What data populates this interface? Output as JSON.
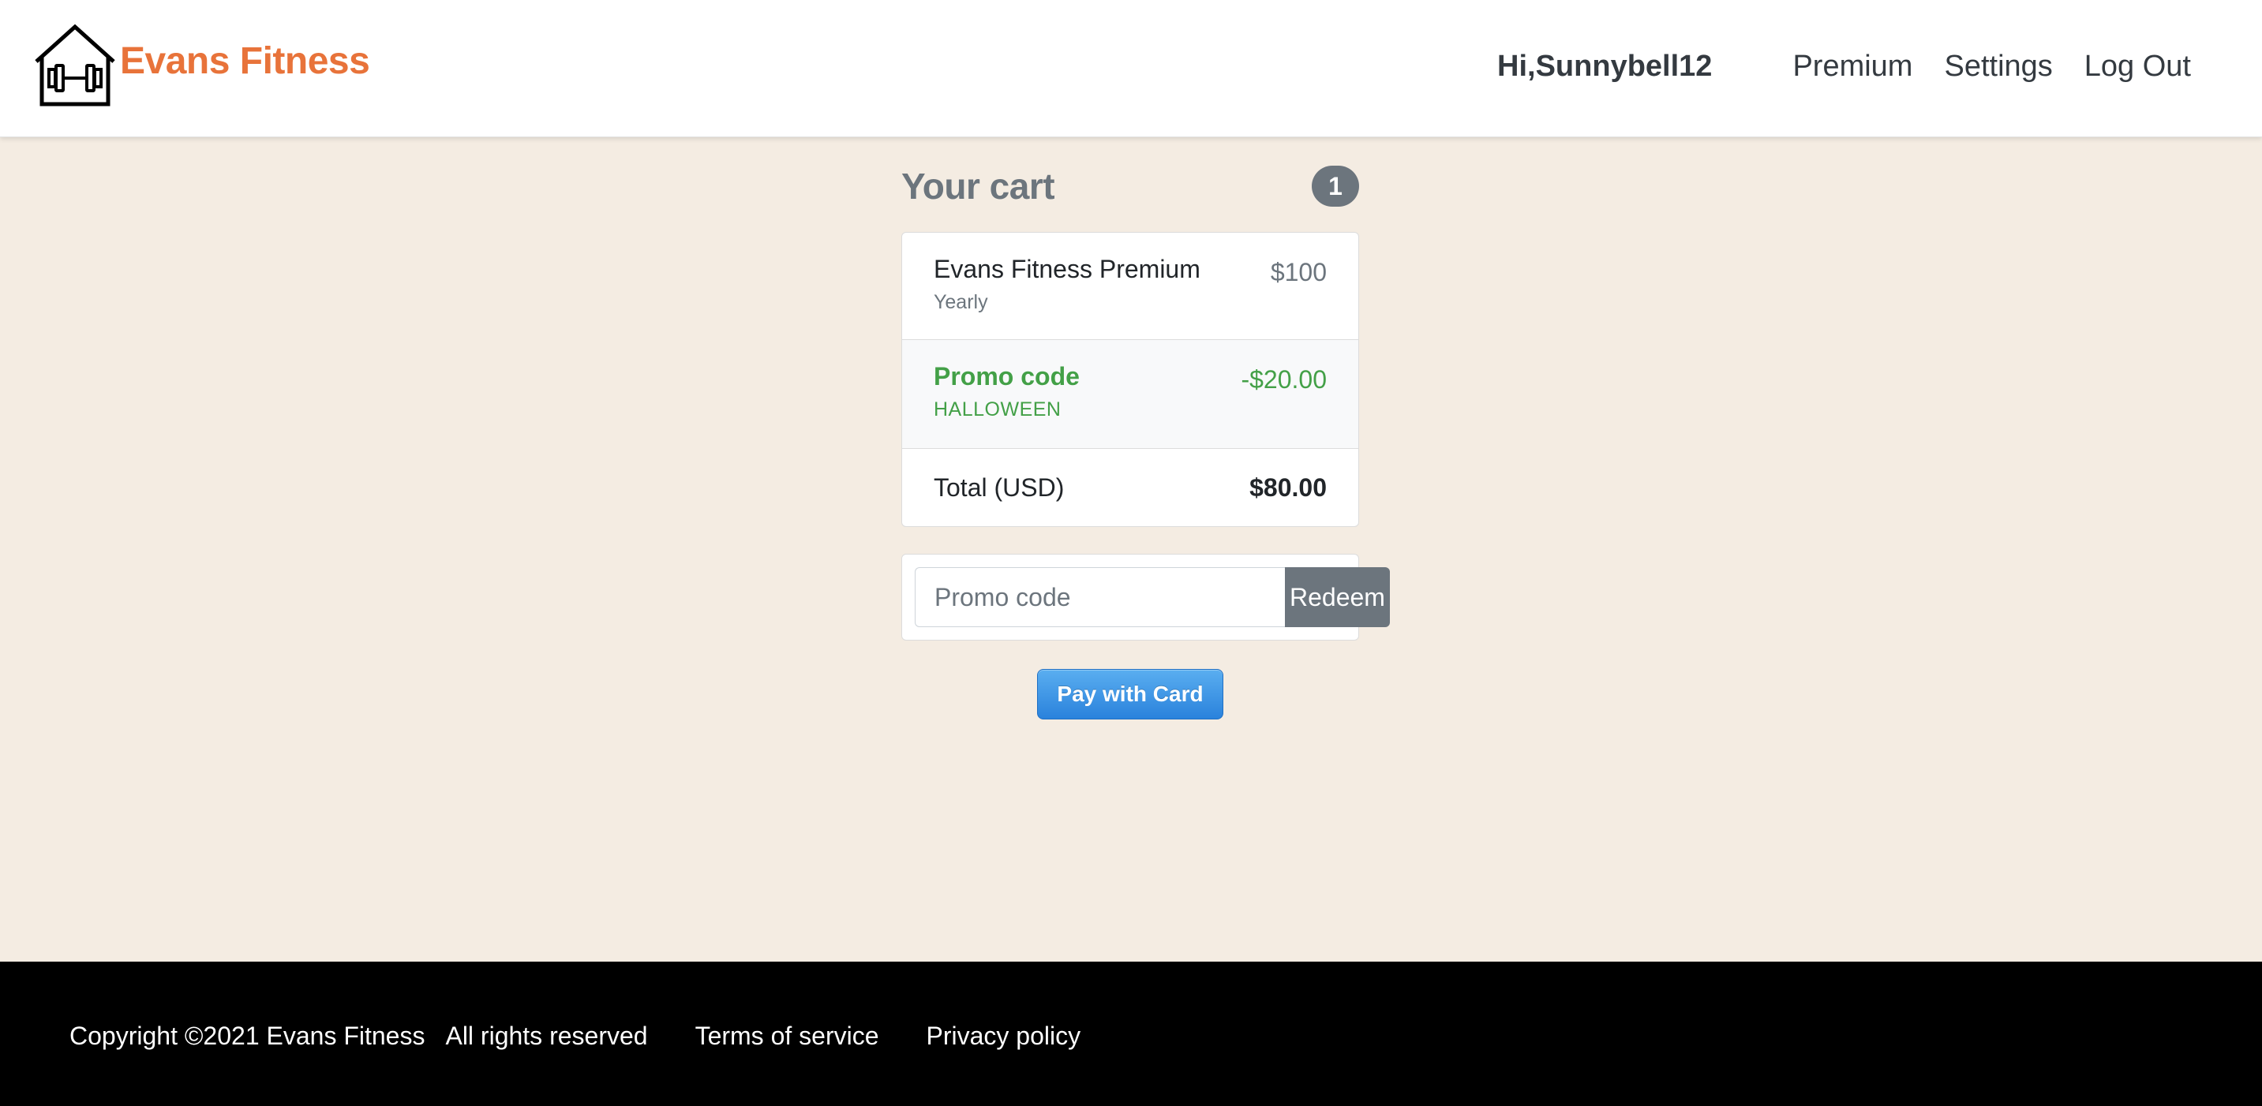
{
  "brand": {
    "name": "Evans Fitness",
    "color": "#e8733a"
  },
  "nav": {
    "greeting": "Hi,Sunnybell12",
    "links": [
      "Premium",
      "Settings",
      "Log Out"
    ]
  },
  "cart": {
    "title": "Your cart",
    "count": "1",
    "item": {
      "name": "Evans Fitness Premium",
      "period": "Yearly",
      "price": "$100"
    },
    "promo": {
      "label": "Promo code",
      "code": "HALLOWEEN",
      "amount": "-$20.00",
      "color": "#43a047"
    },
    "total": {
      "label": "Total (USD)",
      "value": "$80.00"
    }
  },
  "promo_form": {
    "placeholder": "Promo code",
    "button_label": "Redeem"
  },
  "pay_button": {
    "label": "Pay with Card",
    "color": "#2a82dc"
  },
  "footer": {
    "copyright": "Copyright ©2021 Evans Fitness",
    "rights": "All rights reserved",
    "links": [
      "Terms of service",
      "Privacy policy"
    ]
  },
  "icons": {
    "logo": "house-dumbbell-icon"
  }
}
